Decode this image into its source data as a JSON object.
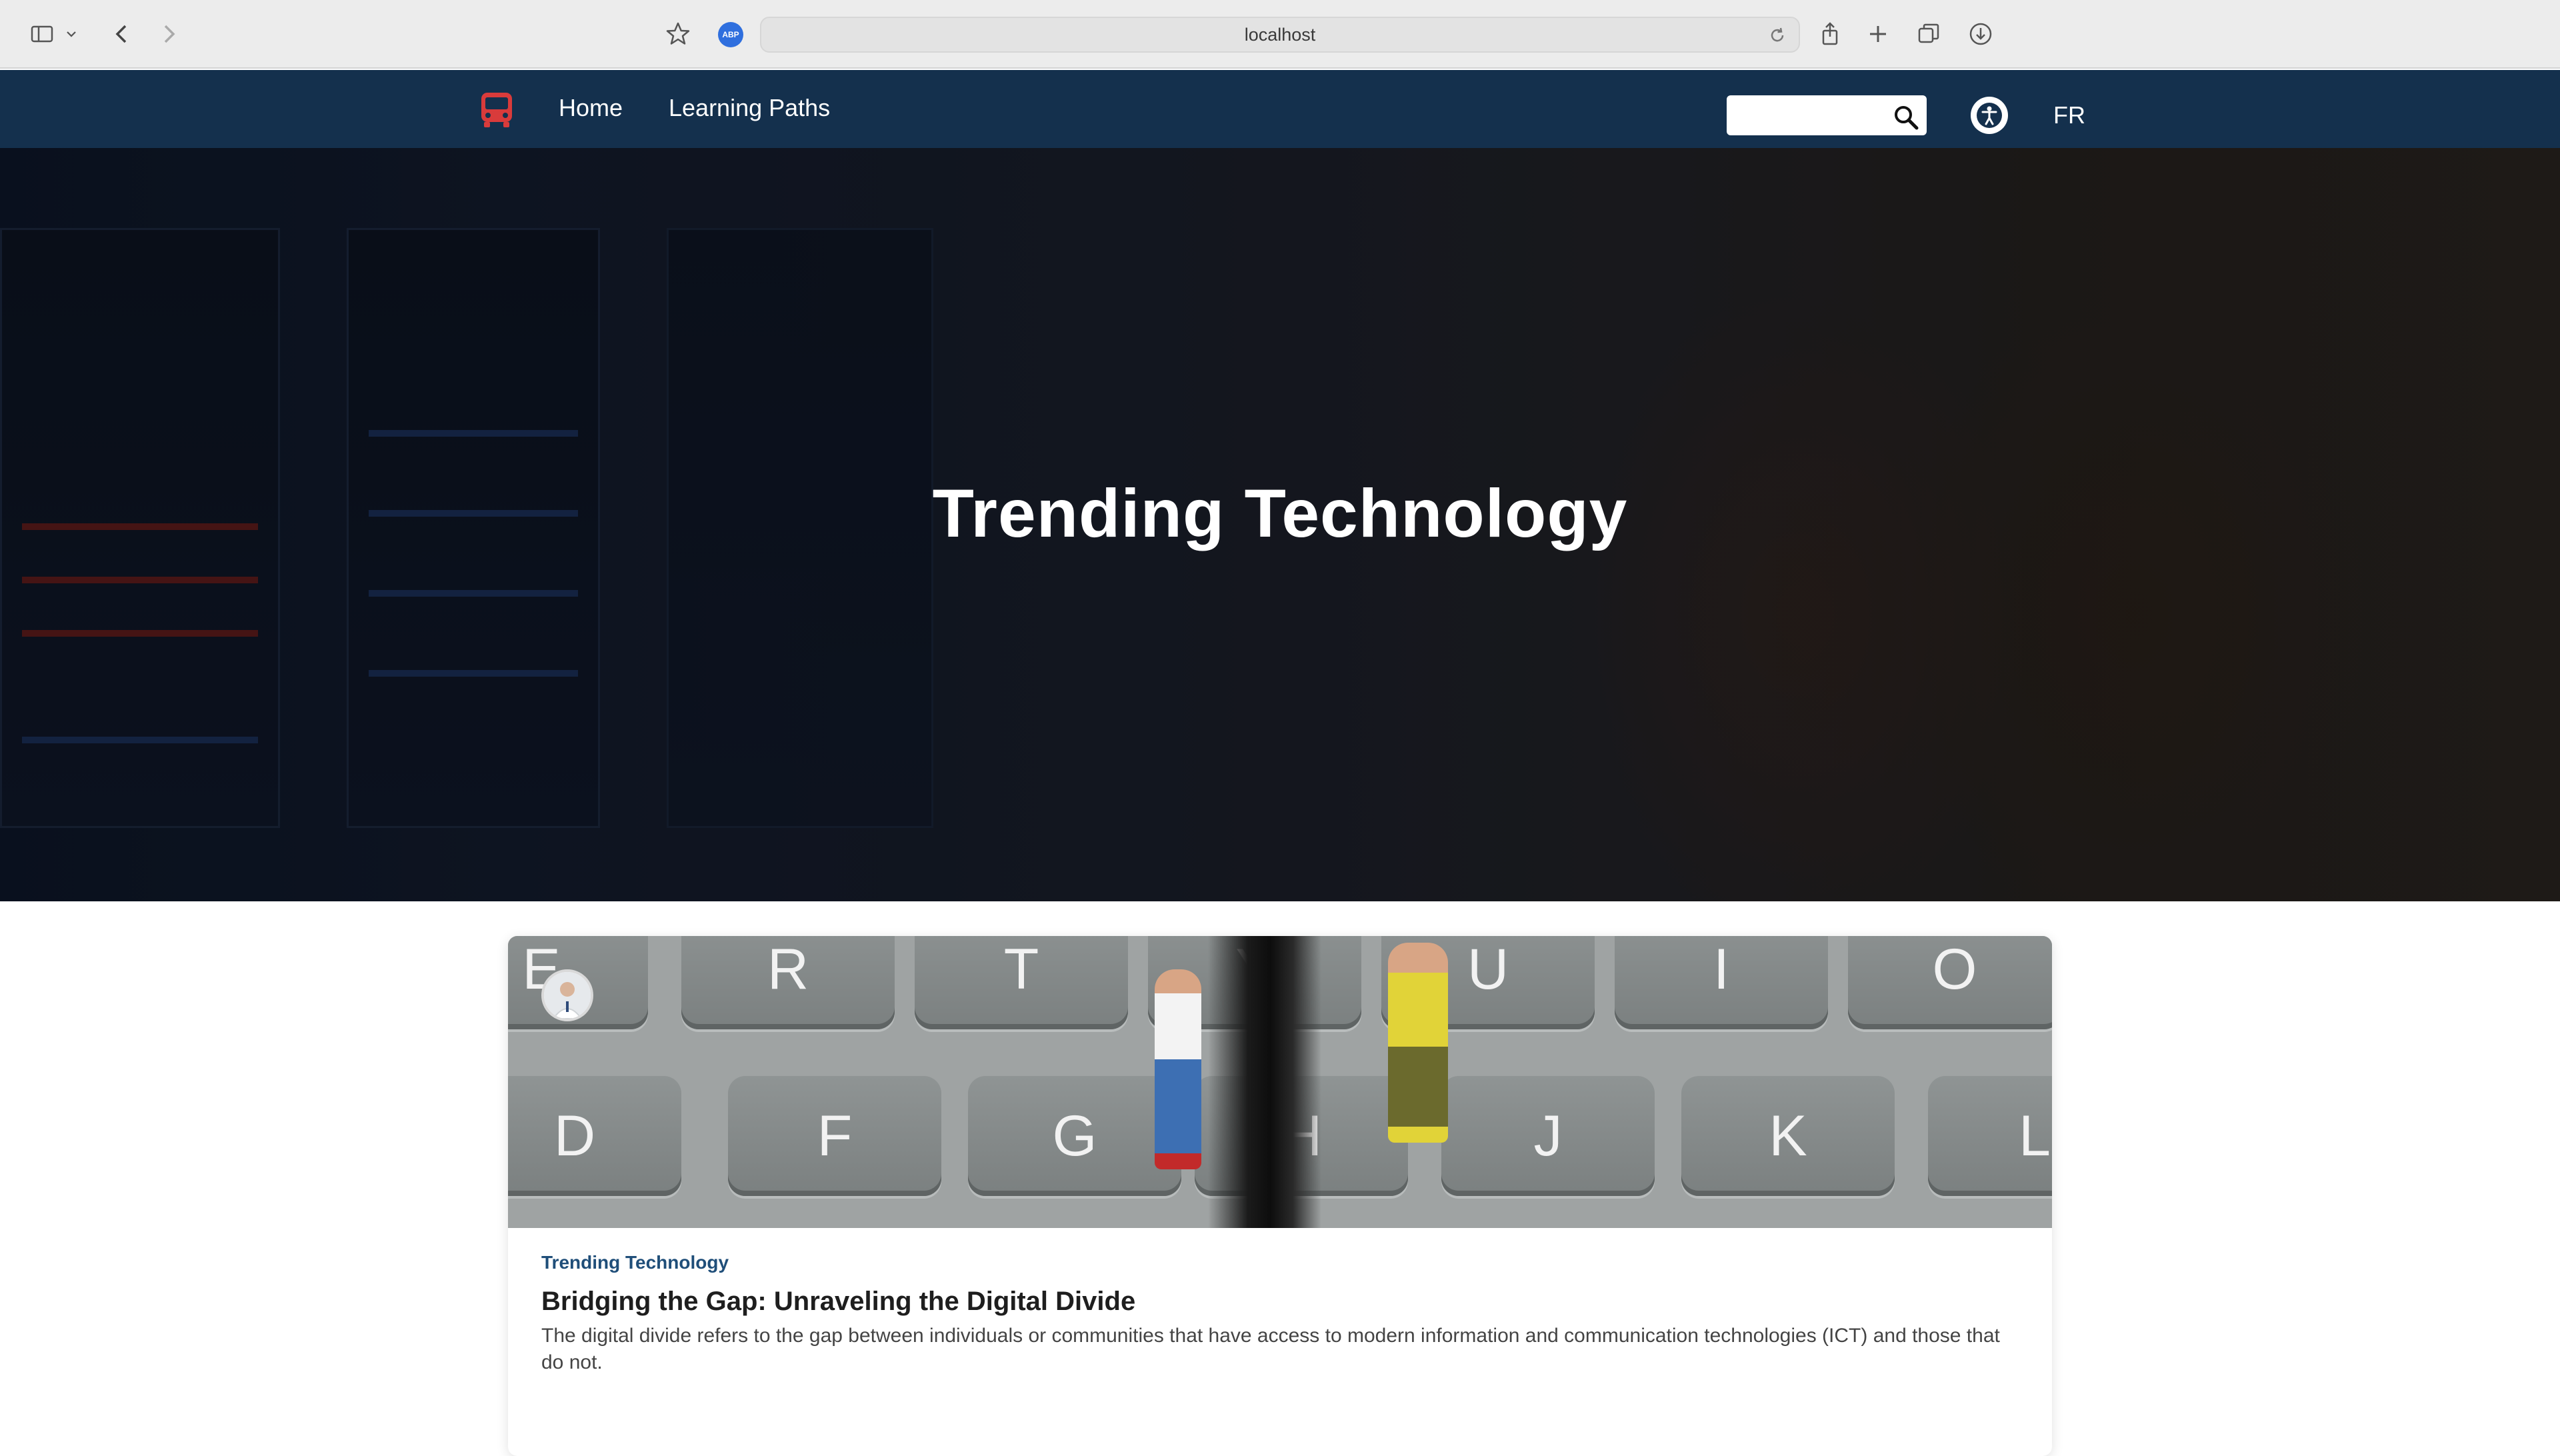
{
  "browser": {
    "url": "localhost",
    "abp_label": "ABP"
  },
  "nav": {
    "links": [
      {
        "label": "Home"
      },
      {
        "label": "Learning Paths"
      }
    ],
    "search_placeholder": "",
    "language_toggle": "FR"
  },
  "hero": {
    "title": "Trending Technology"
  },
  "article": {
    "category": "Trending Technology",
    "title": "Bridging the Gap: Unraveling the Digital Divide",
    "summary": "The digital divide refers to the gap between individuals or communities that have access to modern information and communication technologies (ICT) and those that do not.",
    "keys_top": [
      "E",
      "R",
      "T",
      "Y",
      "U",
      "I",
      "O"
    ],
    "keys_bottom": [
      "D",
      "F",
      "G",
      "H",
      "J",
      "K",
      "L"
    ]
  },
  "colors": {
    "nav_bg": "#14304d",
    "logo_red": "#d93b3b",
    "category_blue": "#1f4e79"
  },
  "icons": [
    "sidebar-icon",
    "chevron-down-icon",
    "back-icon",
    "forward-icon",
    "star-icon",
    "reload-icon",
    "share-icon",
    "new-tab-icon",
    "tabs-icon",
    "download-icon",
    "bus-icon",
    "search-icon",
    "accessibility-icon"
  ]
}
